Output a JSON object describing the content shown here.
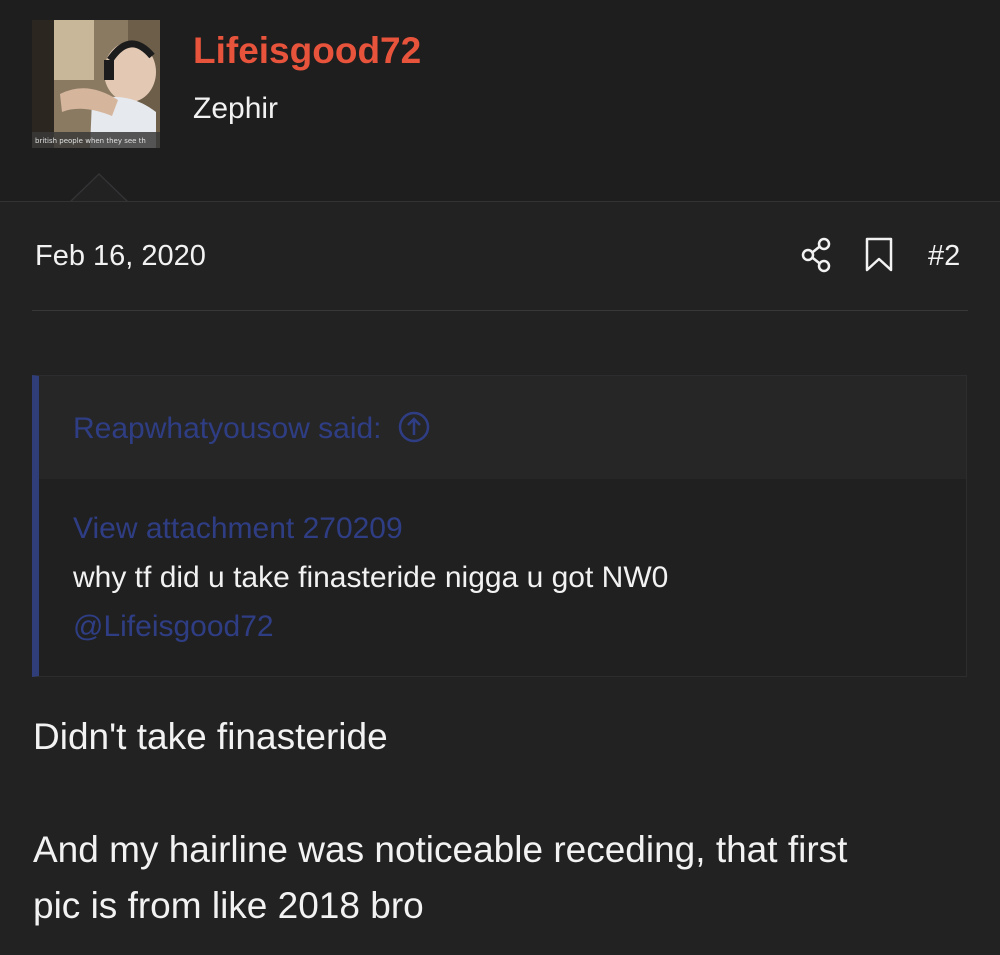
{
  "user": {
    "name": "Lifeisgood72",
    "title": "Zephir",
    "avatar_caption": "british people when they see th",
    "name_color": "#e8533b"
  },
  "post": {
    "date": "Feb 16, 2020",
    "number": "#2",
    "share_icon": "share-icon",
    "bookmark_icon": "bookmark-icon"
  },
  "quote": {
    "attribution": "Reapwhatyousow said:",
    "attribution_icon": "arrow-up-circle-icon",
    "attachment_link": "View attachment 270209",
    "text": "why tf did u take finasteride nigga u got NW0",
    "mention": "@Lifeisgood72",
    "accent_color": "#2f3d78"
  },
  "body": {
    "line1": "Didn't take finasteride",
    "line2": "And my hairline was noticeable receding, that first",
    "line3": "pic is from like 2018 bro"
  }
}
